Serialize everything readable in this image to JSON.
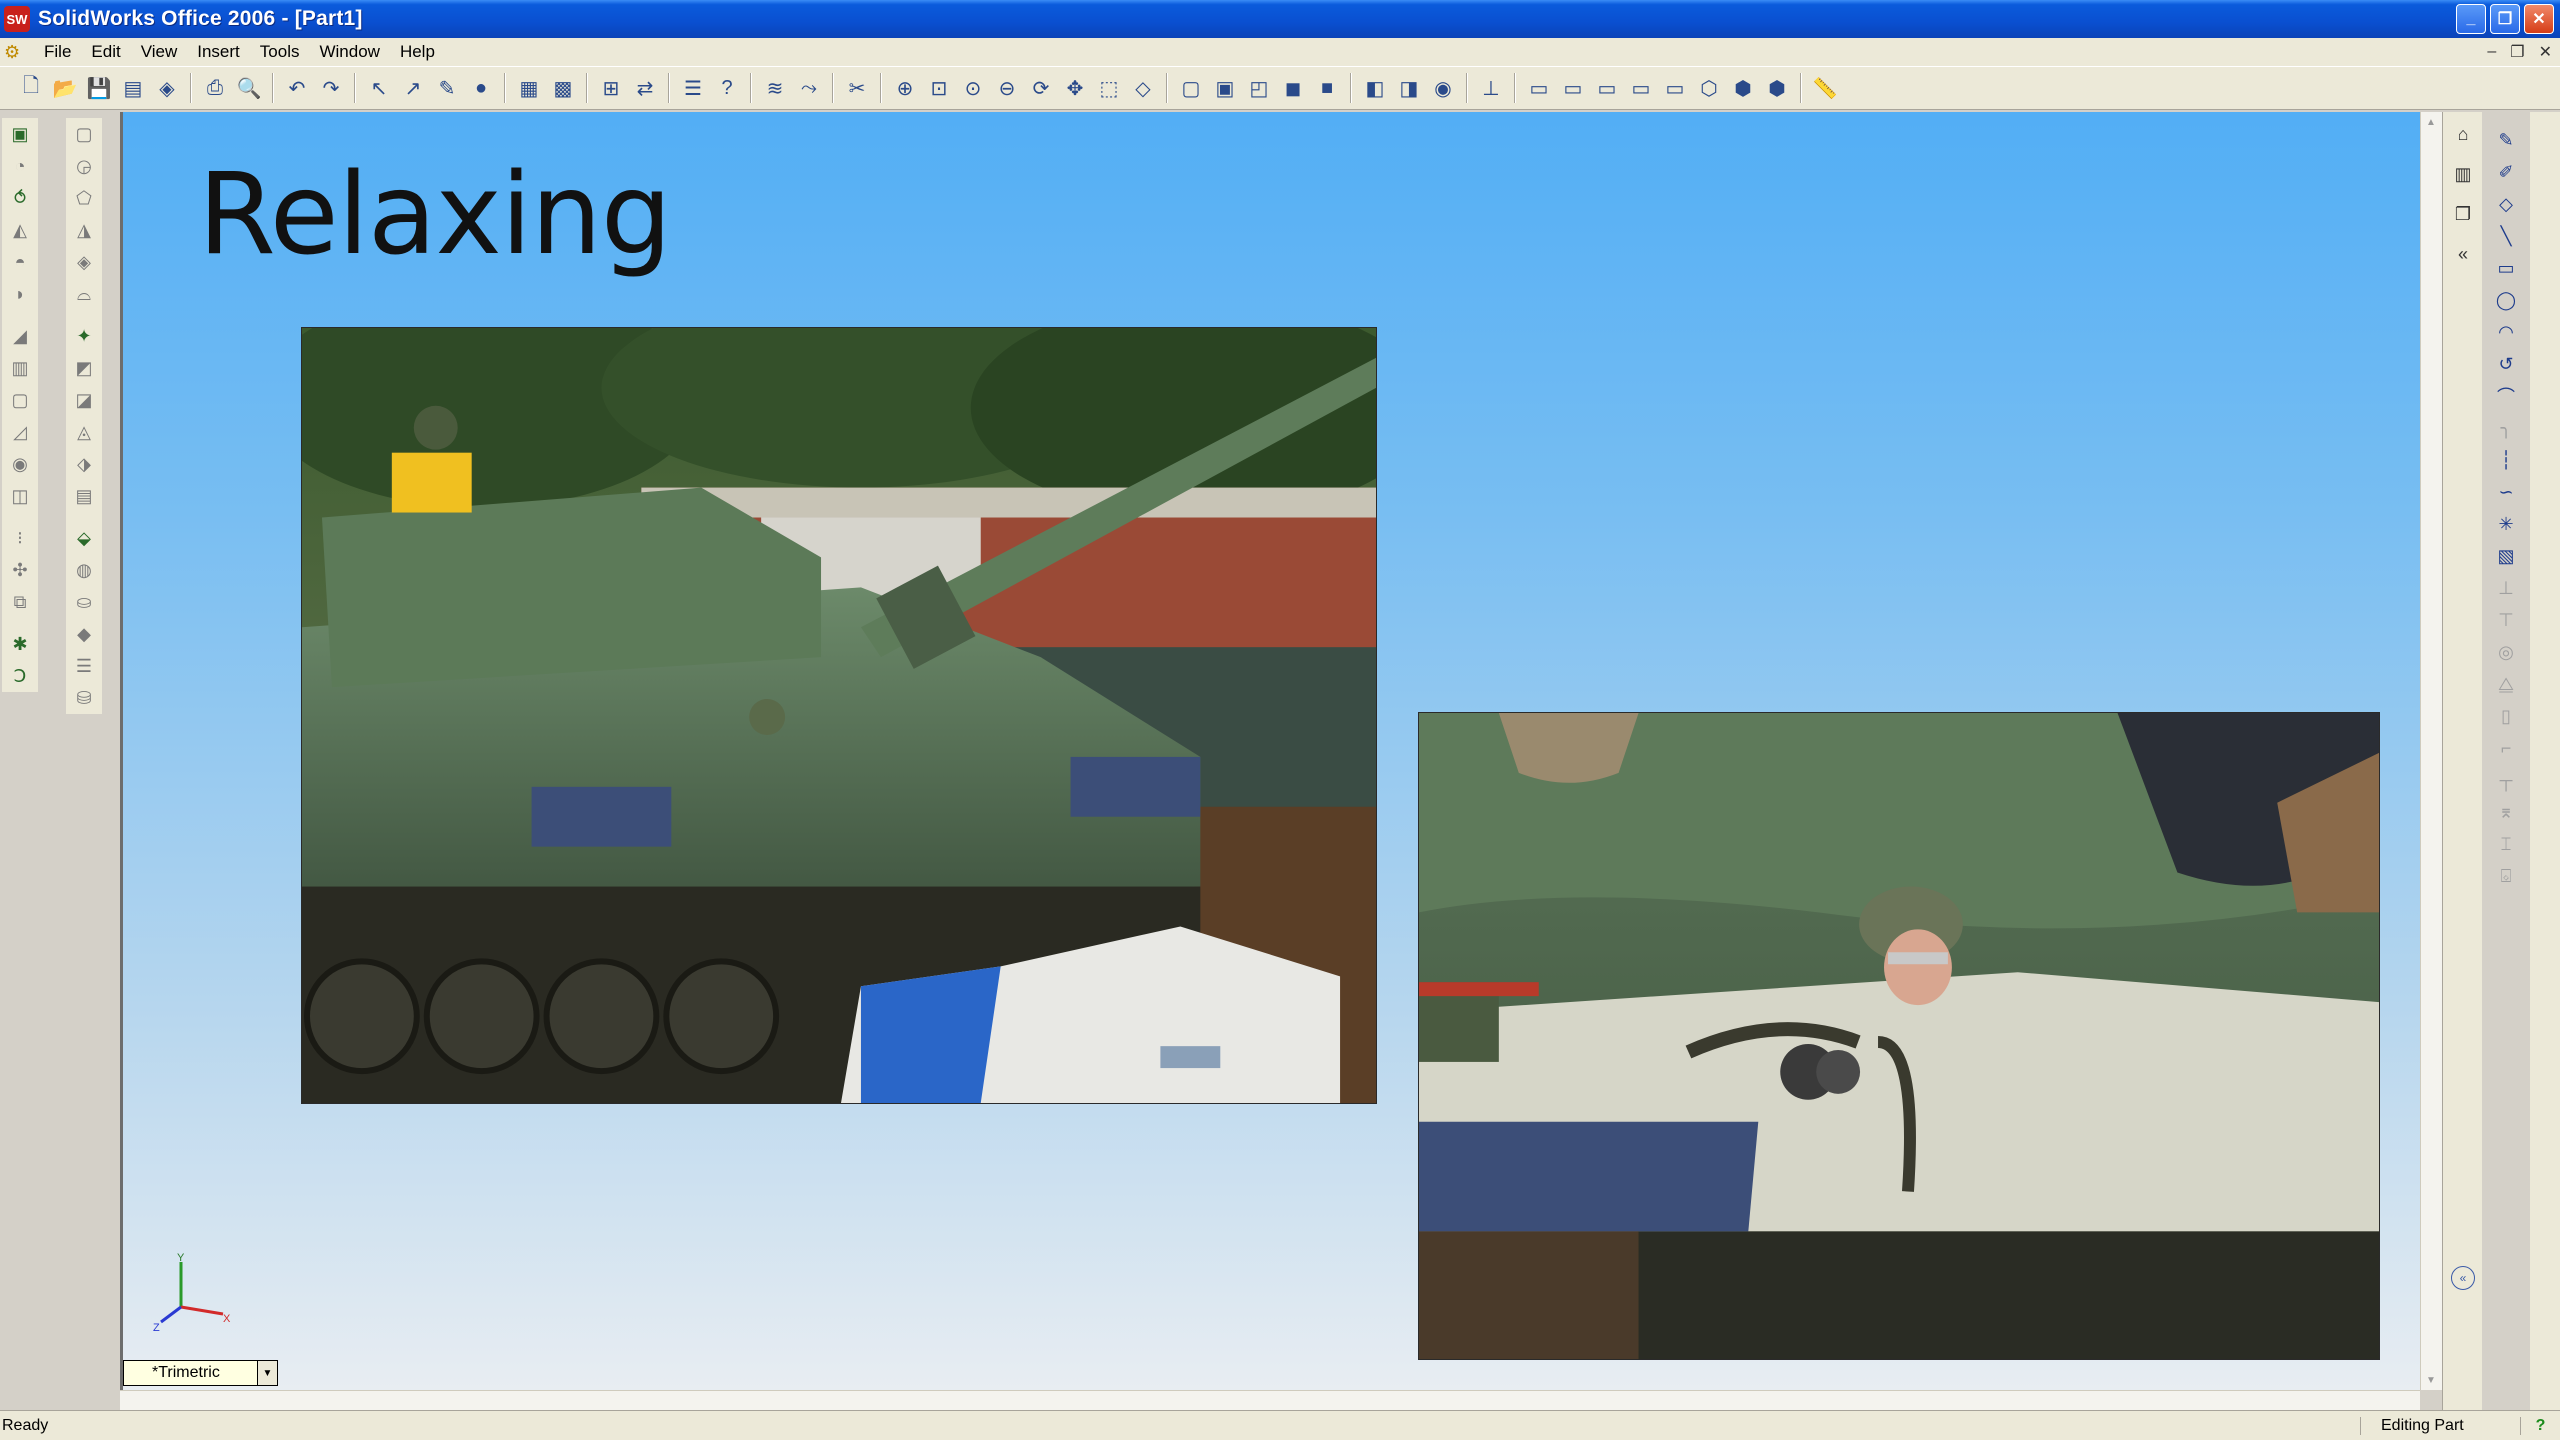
{
  "window": {
    "title": "SolidWorks Office 2006 - [Part1]",
    "app_icon": "sw"
  },
  "menu": [
    "File",
    "Edit",
    "View",
    "Insert",
    "Tools",
    "Window",
    "Help"
  ],
  "slide": {
    "title": "Relaxing"
  },
  "view": {
    "orientation": "*Trimetric"
  },
  "triad": {
    "x": "X",
    "y": "Y",
    "z": "Z"
  },
  "status": {
    "left": "Ready",
    "right": "Editing Part",
    "help": "?"
  },
  "colors": {
    "titlebar": "#0a4fd0",
    "background_top": "#52aef5",
    "background_bottom": "#e8edf2"
  },
  "icons": {
    "toolbar": [
      "new-icon",
      "open-icon",
      "save-icon",
      "print-icon",
      "publish-icon",
      "print2-icon",
      "preview-icon",
      "undo-icon",
      "redo-icon",
      "select-icon",
      "smart-select-icon",
      "sketch-icon",
      "light-icon",
      "grid-icon",
      "options-icon",
      "dimxpert-icon",
      "compare-icon",
      "properties-icon",
      "help-icon",
      "layer-icon",
      "routing-icon",
      "sketch-tools-icon",
      "zoom-fit-icon",
      "zoom-area-icon",
      "zoom-in-icon",
      "zoom-out-icon",
      "rotate-icon",
      "pan-icon",
      "3d-icon",
      "view-orientation-icon",
      "wireframe-icon",
      "hidden-lines-icon",
      "hlr-icon",
      "shaded-edges-icon",
      "shaded-icon",
      "section-icon",
      "perspective-icon",
      "realview-icon",
      "plane-icon",
      "front-view-icon",
      "back-view-icon",
      "left-view-icon",
      "right-view-icon",
      "top-view-icon",
      "iso-icon",
      "dimetric-icon",
      "trimetric-icon",
      "measure-icon"
    ]
  }
}
